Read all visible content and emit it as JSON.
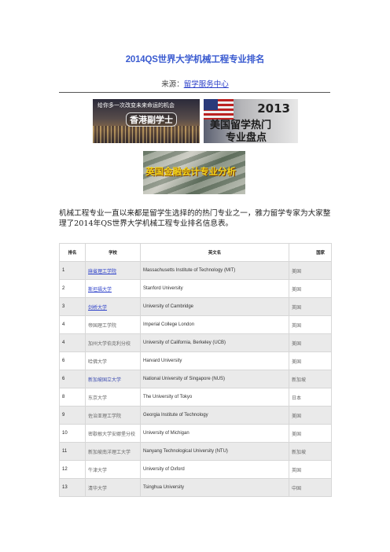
{
  "title": "2014QS世界大学机械工程专业排名",
  "source": {
    "label": "来源：",
    "link_text": "留学服务中心"
  },
  "banners": {
    "hk": {
      "line1": "给你多一次改变未来命运的机会",
      "line2": "香港副学士"
    },
    "us": {
      "year": "2013",
      "line1": "美国留学热门",
      "line2": "专业盘点"
    },
    "acc": {
      "text": "英国金融会计专业分析"
    }
  },
  "intro": "机械工程专业一直以来都是留学生选择的的热门专业之一，雅力留学专家为大家整理了2014年QS世界大学机械工程专业排名信息表。",
  "table": {
    "headers": [
      "排名",
      "学校",
      "英文名",
      "国家"
    ],
    "rows": [
      {
        "rank": "1",
        "school": "麻省理工学院",
        "english": "Massachusetts Institute of Technology (MIT)",
        "country": "美国",
        "link": true
      },
      {
        "rank": "2",
        "school": "斯坦福大学",
        "english": "Stanford University",
        "country": "美国",
        "link": true
      },
      {
        "rank": "3",
        "school": "剑桥大学",
        "english": "University of Cambridge",
        "country": "英国",
        "link": true
      },
      {
        "rank": "4",
        "school": "帝国理工学院",
        "english": "Imperial College London",
        "country": "英国",
        "link": false
      },
      {
        "rank": "4",
        "school": "加州大学伯克利分校",
        "english": "University of California, Berkeley (UCB)",
        "country": "美国",
        "link": false
      },
      {
        "rank": "6",
        "school": "哈佛大学",
        "english": "Harvard University",
        "country": "美国",
        "link": false
      },
      {
        "rank": "6",
        "school": "新加坡国立大学",
        "english": "National University of Singapore (NUS)",
        "country": "新加坡",
        "link": "plain-blue"
      },
      {
        "rank": "8",
        "school": "东京大学",
        "english": "The University of Tokyo",
        "country": "日本",
        "link": false
      },
      {
        "rank": "9",
        "school": "佐治亚理工学院",
        "english": "Georgia Institute of Technology",
        "country": "美国",
        "link": false
      },
      {
        "rank": "10",
        "school": "密歇根大学安娜堡分校",
        "english": "University of Michigan",
        "country": "美国",
        "link": false
      },
      {
        "rank": "11",
        "school": "新加坡南洋理工大学",
        "english": "Nanyang Technological University (NTU)",
        "country": "新加坡",
        "link": false
      },
      {
        "rank": "12",
        "school": "牛津大学",
        "english": "University of Oxford",
        "country": "英国",
        "link": false
      },
      {
        "rank": "13",
        "school": "清华大学",
        "english": "Tsinghua University",
        "country": "中国",
        "link": false
      }
    ]
  }
}
